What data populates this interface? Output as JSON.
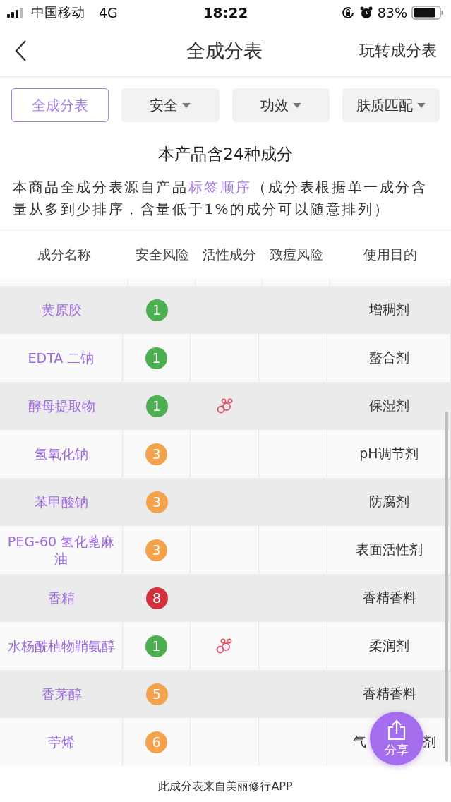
{
  "status_bar": {
    "carrier": "中国移动",
    "network": "4G",
    "time": "18:22",
    "battery": "83%"
  },
  "nav": {
    "title": "全成分表",
    "action": "玩转成分表"
  },
  "filters": [
    {
      "label": "全成分表",
      "selected": true,
      "dropdown": false
    },
    {
      "label": "安全",
      "selected": false,
      "dropdown": true
    },
    {
      "label": "功效",
      "selected": false,
      "dropdown": true
    },
    {
      "label": "肤质匹配",
      "selected": false,
      "dropdown": true
    }
  ],
  "summary": "本产品含24种成分",
  "note": {
    "before": "本商品全成分表源自产品",
    "link": "标签顺序",
    "after": "（成分表根据单一成分含量从多到少排序，含量低于1%的成分可以随意排列）"
  },
  "table": {
    "columns": [
      "成分名称",
      "安全风险",
      "活性成分",
      "致痘风险",
      "使用目的"
    ],
    "rows": [
      {
        "name": "黄原胶",
        "risk": "1",
        "color": "#4caf50",
        "active": false,
        "purpose": "增稠剂"
      },
      {
        "name": "EDTA 二钠",
        "risk": "1",
        "color": "#4caf50",
        "active": false,
        "purpose": "螯合剂"
      },
      {
        "name": "酵母提取物",
        "risk": "1",
        "color": "#4caf50",
        "active": true,
        "purpose": "保湿剂"
      },
      {
        "name": "氢氧化钠",
        "risk": "3",
        "color": "#f4a34c",
        "active": false,
        "purpose": "pH调节剂"
      },
      {
        "name": "苯甲酸钠",
        "risk": "3",
        "color": "#f4a34c",
        "active": false,
        "purpose": "防腐剂"
      },
      {
        "name": "PEG-60 氢化蓖麻油",
        "risk": "3",
        "color": "#f4a34c",
        "active": false,
        "purpose": "表面活性剂"
      },
      {
        "name": "香精",
        "risk": "8",
        "color": "#d0313d",
        "active": false,
        "purpose": "香精香料"
      },
      {
        "name": "水杨酰植物鞘氨醇",
        "risk": "1",
        "color": "#4caf50",
        "active": true,
        "purpose": "柔润剂"
      },
      {
        "name": "香茅醇",
        "risk": "5",
        "color": "#f4a34c",
        "active": false,
        "purpose": "香精香料"
      },
      {
        "name": "苧烯",
        "risk": "6",
        "color": "#f4a34c",
        "active": false,
        "purpose": "气",
        "purpose_end": "剂"
      }
    ]
  },
  "share_button": "分享",
  "footer": "此成分表来自美丽修行APP"
}
